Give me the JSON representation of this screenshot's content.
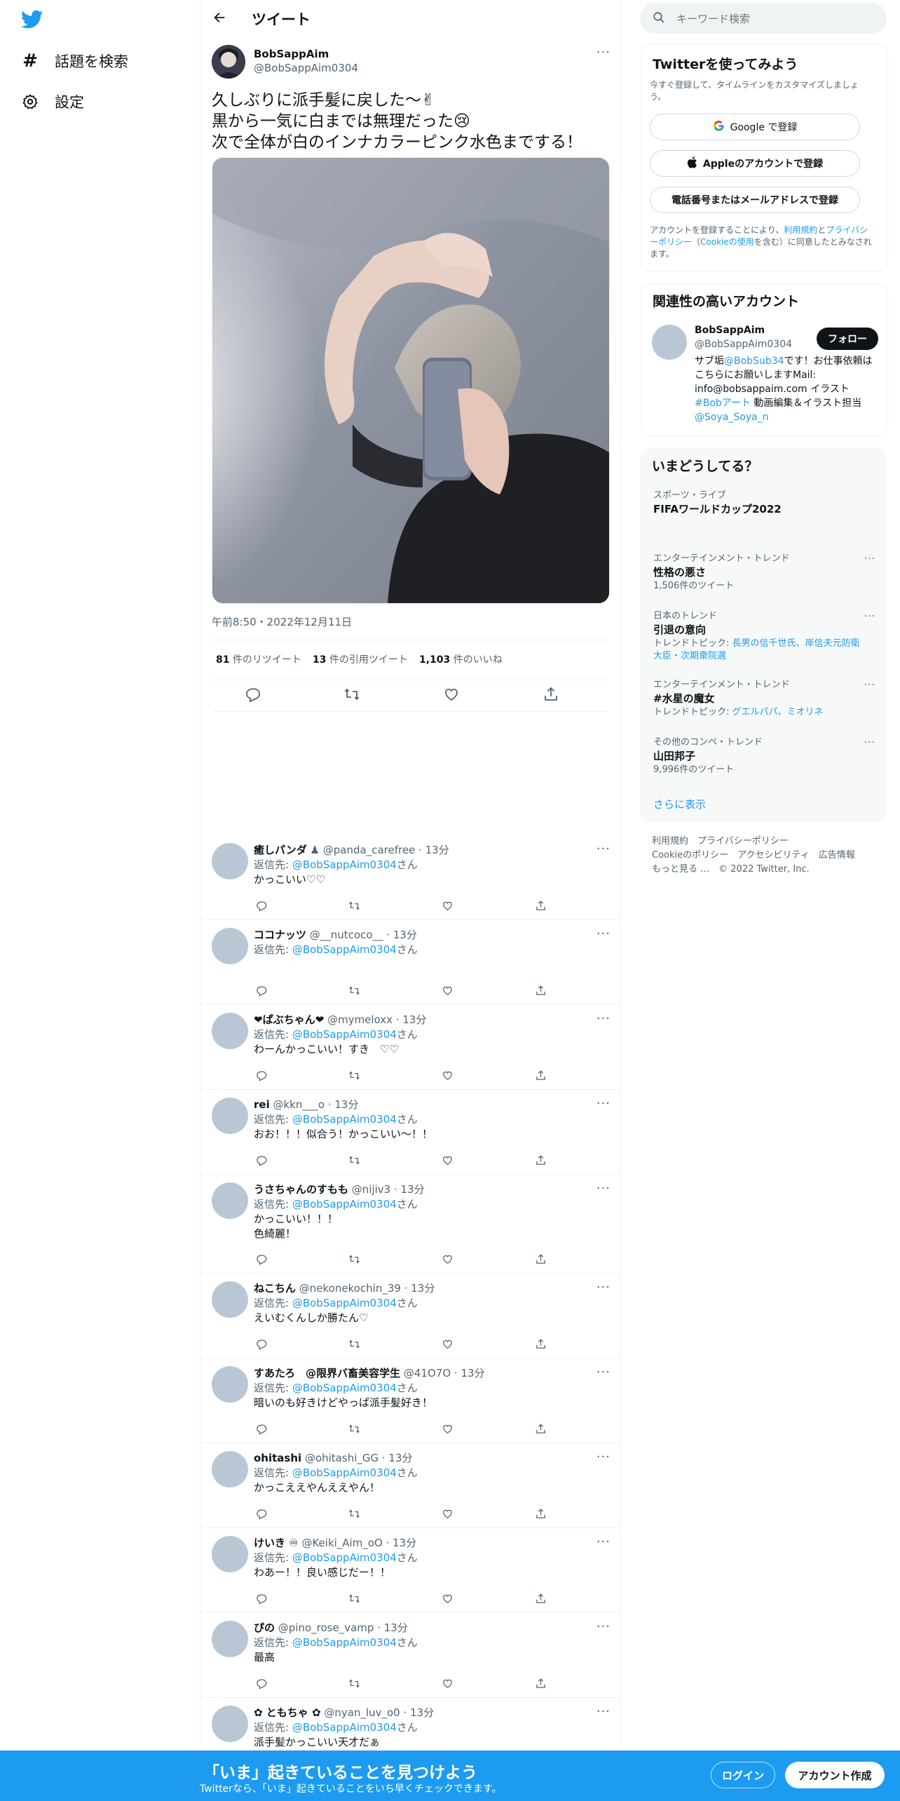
{
  "nav": {
    "explore_label": "話題を検索",
    "settings_label": "設定"
  },
  "header": {
    "title": "ツイート"
  },
  "tweet": {
    "author_name": "BobSappAim",
    "author_handle": "@BobSappAim0304",
    "line1": "久しぶりに派手髪に戻した〜✌",
    "line2": "黒から一気に白までは無理だった😢",
    "line3": "次で全体が白のインナカラーピンク水色までする！",
    "timestamp": "午前8:50・2022年12月11日",
    "retweets_count": "81",
    "retweets_label": "件のリツイート",
    "quotes_count": "13",
    "quotes_label": "件の引用ツイート",
    "likes_count": "1,103",
    "likes_label": "件のいいね"
  },
  "replies": [
    {
      "name": "癒しパンダ",
      "meta": "♟ @panda_carefree · 13分",
      "to_prefix": "返信先: ",
      "to_handle": "@BobSappAim0304",
      "to_suffix": "さん",
      "text": "かっこいい♡♡"
    },
    {
      "name": "ココナッツ",
      "meta": "@__nutcoco__ · 13分",
      "to_prefix": "返信先: ",
      "to_handle": "@BobSappAim0304",
      "to_suffix": "さん",
      "text": ""
    },
    {
      "name": "❤ぱぶちゃん❤",
      "meta": "@mymeloxx · 13分",
      "to_prefix": "返信先: ",
      "to_handle": "@BobSappAim0304",
      "to_suffix": "さん",
      "text": "わーんかっこいい！すき　♡♡"
    },
    {
      "name": "rei",
      "meta": "@kkn___o · 13分",
      "to_prefix": "返信先: ",
      "to_handle": "@BobSappAim0304",
      "to_suffix": "さん",
      "text": "おお！！！似合う！かっこいい〜！！"
    },
    {
      "name": "うさちゃんのすもも",
      "meta": "@nijiv3 · 13分",
      "to_prefix": "返信先: ",
      "to_handle": "@BobSappAim0304",
      "to_suffix": "さん",
      "text": "かっこいい！！！\n色綺麗！"
    },
    {
      "name": "ねこちん",
      "meta": "@nekonekochin_39 · 13分",
      "to_prefix": "返信先: ",
      "to_handle": "@BobSappAim0304",
      "to_suffix": "さん",
      "text": "えいむくんしか勝たん♡"
    },
    {
      "name": "すあたろ　@限界バ畜美容学生",
      "meta": "@41O7O · 13分",
      "to_prefix": "返信先: ",
      "to_handle": "@BobSappAim0304",
      "to_suffix": "さん",
      "text": "暗いのも好きけどやっぱ派手髪好き！"
    },
    {
      "name": "ohitashi",
      "meta": "@ohitashi_GG · 13分",
      "to_prefix": "返信先: ",
      "to_handle": "@BobSappAim0304",
      "to_suffix": "さん",
      "text": "かっこええやんええやん！"
    },
    {
      "name": "けいき ♾",
      "meta": "@Keiki_Aim_oO · 13分",
      "to_prefix": "返信先: ",
      "to_handle": "@BobSappAim0304",
      "to_suffix": "さん",
      "text": "わあー！！良い感じだー！！"
    },
    {
      "name": "ぴの",
      "meta": "@pino_rose_vamp · 13分",
      "to_prefix": "返信先: ",
      "to_handle": "@BobSappAim0304",
      "to_suffix": "さん",
      "text": "最高"
    },
    {
      "name": "✿ ともちゃ ✿",
      "meta": "@nyan_luv_o0 · 13分",
      "to_prefix": "返信先: ",
      "to_handle": "@BobSappAim0304",
      "to_suffix": "さん",
      "text": "派手髪かっこいい天才だぁ"
    }
  ],
  "search": {
    "placeholder": "キーワード検索"
  },
  "signup": {
    "title": "Twitterを使ってみよう",
    "subtitle": "今すぐ登録して、タイムラインをカスタマイズしましょう。",
    "google_label": "Google で登録",
    "apple_label": "Appleのアカウントで登録",
    "phone_label": "電話番号またはメールアドレスで登録",
    "terms_prefix": "アカウントを登録することにより、",
    "terms_link": "利用規約",
    "terms_and": "と",
    "privacy_link": "プライバシーポリシー",
    "cookie_open": "（",
    "cookie_link": "Cookieの使用",
    "terms_suffix": "を含む）に同意したとみなされます。"
  },
  "related": {
    "title": "関連性の高いアカウント",
    "name": "BobSappAim",
    "handle": "@BobSappAim0304",
    "follow_label": "フォロー",
    "bio_1": "サブ垢",
    "bio_link1": "@BobSub34",
    "bio_2": "です！お仕事依頼はこちらにお願いしますMail: info@bobsappaim.com イラスト",
    "bio_link2": "#Bobアート",
    "bio_3": " 動画編集＆イラスト担当",
    "bio_link3": "@Soya_Soya_n"
  },
  "trends": {
    "title": "いまどうしてる？",
    "items": [
      {
        "category": "スポーツ・ライブ",
        "name": "FIFAワールドカップ2022",
        "extra": ""
      },
      {
        "category": "エンターテインメント・トレンド",
        "name": "性格の悪さ",
        "extra": "1,506件のツイート"
      },
      {
        "category": "日本のトレンド",
        "name": "引退の意向",
        "extra_prefix": "トレンドトピック: ",
        "extra": "長男の信千世氏、岸信夫元防衛大臣・次期衆院選"
      },
      {
        "category": "エンターテインメント・トレンド",
        "name": "#水星の魔女",
        "extra_prefix": "トレンドトピック: ",
        "extra": "グエルパパ、ミオリネ"
      },
      {
        "category": "その他のコンペ・トレンド",
        "name": "山田邦子",
        "extra": "9,996件のツイート"
      }
    ],
    "show_more": "さらに表示"
  },
  "footer": {
    "terms": "利用規約",
    "privacy": "プライバシーポリシー",
    "cookie": "Cookieのポリシー",
    "accessibility": "アクセシビリティ",
    "ads": "広告情報",
    "more": "もっと見る …",
    "copyright": "© 2022 Twitter, Inc."
  },
  "bottom": {
    "title": "「いま」起きていることを見つけよう",
    "subtitle": "Twitterなら、「いま」起きていることをいち早くチェックできます。",
    "login_label": "ログイン",
    "signup_label": "アカウント作成"
  },
  "colors": {
    "accent": "#1d9bf0",
    "text": "#0f1419",
    "muted": "#536471",
    "card_bg": "#f7f9f9",
    "border": "#eff3f4"
  }
}
